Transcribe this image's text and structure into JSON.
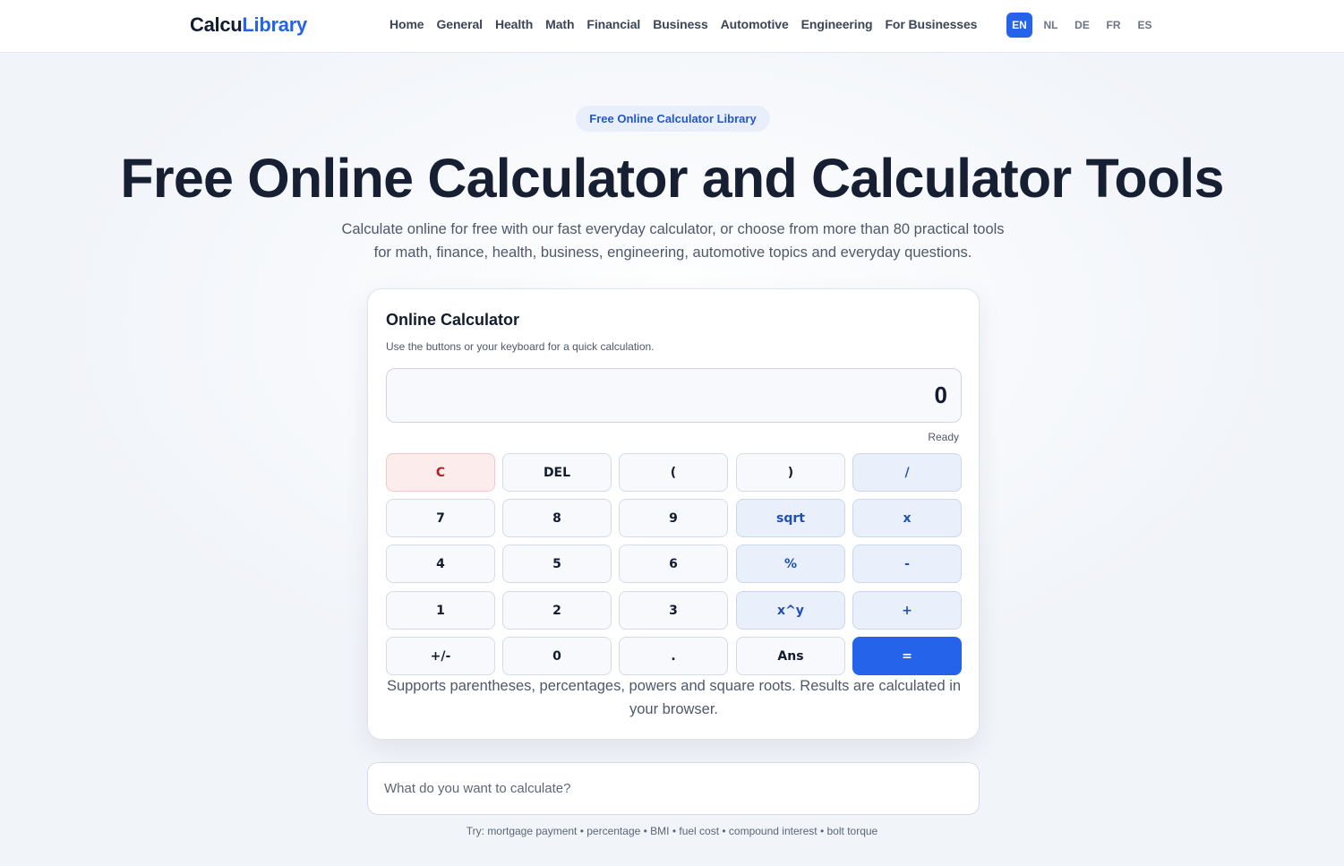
{
  "header": {
    "logo_part1": "Calcu",
    "logo_part2": "Library",
    "nav": [
      "Home",
      "General",
      "Health",
      "Math",
      "Financial",
      "Business",
      "Automotive",
      "Engineering",
      "For Businesses"
    ],
    "languages": [
      "EN",
      "NL",
      "DE",
      "FR",
      "ES"
    ],
    "active_language": "EN"
  },
  "hero": {
    "badge": "Free Online Calculator Library",
    "title": "Free Online Calculator and Calculator Tools",
    "subtitle": "Calculate online for free with our fast everyday calculator, or choose from more than 80 practical tools for math, finance, health, business, engineering, automotive topics and everyday questions."
  },
  "calculator": {
    "title": "Online Calculator",
    "hint": "Use the buttons or your keyboard for a quick calculation.",
    "display": "0",
    "status": "Ready",
    "keys": [
      [
        "C",
        "DEL",
        "(",
        ")",
        "/"
      ],
      [
        "7",
        "8",
        "9",
        "sqrt",
        "x"
      ],
      [
        "4",
        "5",
        "6",
        "%",
        "-"
      ],
      [
        "1",
        "2",
        "3",
        "x^y",
        "+"
      ],
      [
        "+/-",
        "0",
        ".",
        "Ans",
        "="
      ]
    ],
    "footnote": "Supports parentheses, percentages, powers and square roots. Results are calculated in your browser."
  },
  "search": {
    "placeholder": "What do you want to calculate?",
    "try_line": "Try: mortgage payment • percentage • BMI • fuel cost • compound interest • bolt torque"
  },
  "colors": {
    "accent": "#2563eb",
    "clear_key": "#b1241f",
    "text_dark": "#131c2e"
  }
}
